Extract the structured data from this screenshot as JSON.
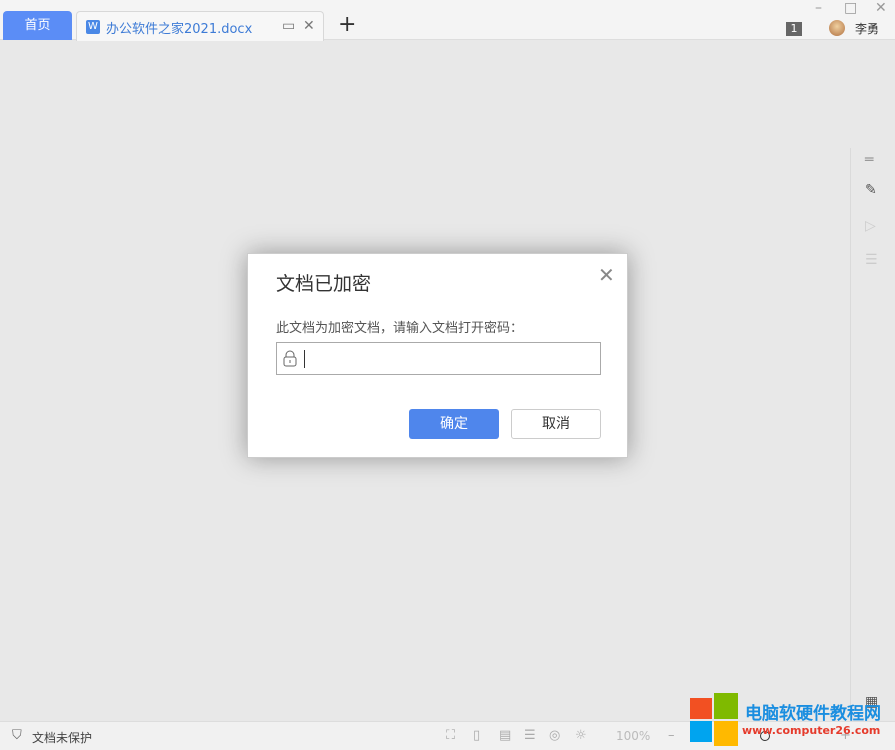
{
  "tabs": {
    "home": "首页",
    "document": "办公软件之家2021.docx"
  },
  "titlebar": {
    "badge_count": "1",
    "user_name": "李勇"
  },
  "dialog": {
    "title": "文档已加密",
    "message": "此文档为加密文档，请输入文档打开密码：",
    "password_value": "",
    "ok_label": "确定",
    "cancel_label": "取消"
  },
  "statusbar": {
    "protection": "文档未保护",
    "zoom": "100%"
  },
  "watermark": {
    "name": "电脑软硬件教程网",
    "url": "www.computer26.com"
  },
  "colors": {
    "accent": "#4f86ec",
    "home_tab": "#5b8df6"
  }
}
